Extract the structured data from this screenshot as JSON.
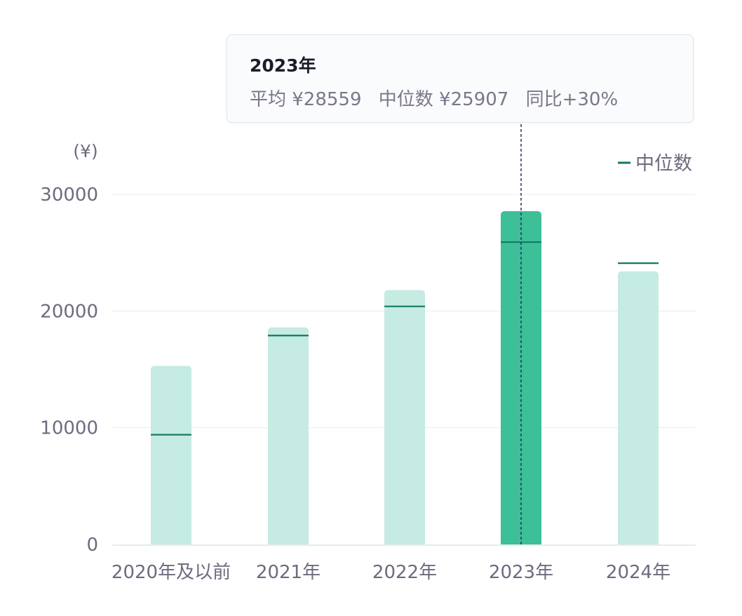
{
  "chart_data": {
    "type": "bar",
    "y_unit_label": "(¥)",
    "categories": [
      "2020年及以前",
      "2021年",
      "2022年",
      "2023年",
      "2024年"
    ],
    "series": [
      {
        "values": [
          15300,
          18600,
          21800,
          28559,
          23400
        ]
      },
      {
        "name": "中位数",
        "values": [
          9400,
          17900,
          20400,
          25907,
          24100
        ]
      }
    ],
    "highlighted_category": "2023年",
    "ylim": [
      0,
      30000
    ],
    "y_ticks": [
      "0",
      "10000",
      "20000",
      "30000"
    ],
    "grid": true,
    "legend": {
      "position": "top-right",
      "entries": [
        "中位数"
      ]
    },
    "colors": {
      "bar": "#c5ebe2",
      "bar_highlight": "#3dbf98",
      "median_line": "#127a63",
      "grid": "#e9ecf3",
      "axis": "#dfe3ec",
      "label": "#6f6a7f",
      "crosshair": "#2d2f5a"
    }
  },
  "tooltip": {
    "title": "2023年",
    "avg_text": "平均 ¥28559",
    "median_text": "中位数 ¥25907",
    "yoy_text": "同比+30%"
  }
}
